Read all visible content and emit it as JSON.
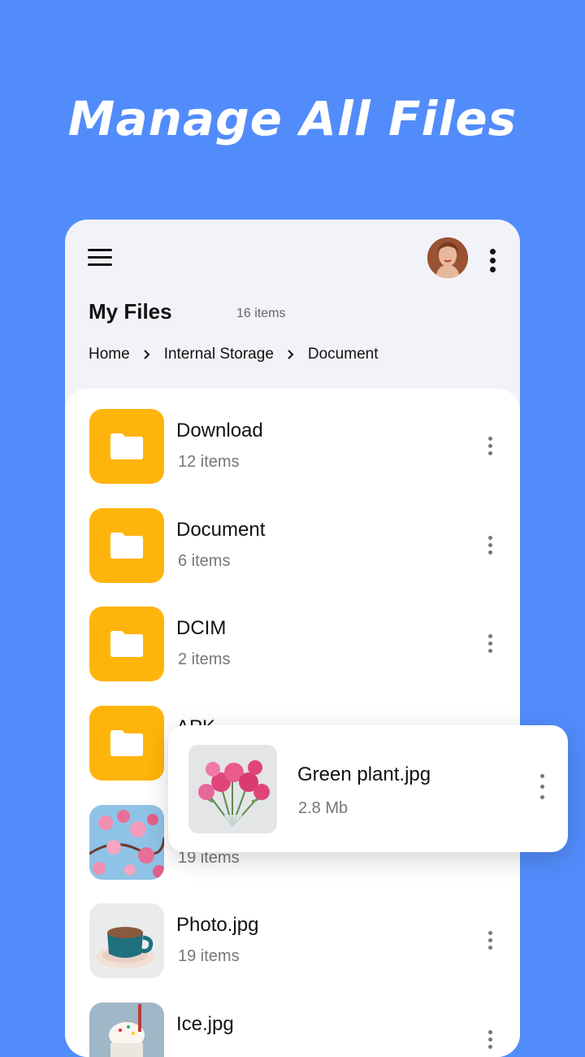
{
  "headline": "Manage All Files",
  "header": {
    "title": "My Files",
    "item_count": "16 items"
  },
  "breadcrumb": [
    "Home",
    "Internal Storage",
    "Document"
  ],
  "files": [
    {
      "name": "Download",
      "sub": "12 items",
      "kind": "folder"
    },
    {
      "name": "Document",
      "sub": "6 items",
      "kind": "folder"
    },
    {
      "name": "DCIM",
      "sub": "2 items",
      "kind": "folder"
    },
    {
      "name": "APK",
      "sub": "",
      "kind": "folder"
    },
    {
      "name": "",
      "sub": "19 items",
      "kind": "image-flowers"
    },
    {
      "name": "Photo.jpg",
      "sub": "19 items",
      "kind": "image-coffee"
    },
    {
      "name": "Ice.jpg",
      "sub": "",
      "kind": "image-icecream"
    }
  ],
  "popup": {
    "name": "Green plant.jpg",
    "size": "2.8 Mb"
  },
  "colors": {
    "background": "#528CFB",
    "folder": "#FFB40B",
    "card": "#F2F3F8"
  },
  "icons": [
    "hamburger-menu-icon",
    "more-vertical-icon",
    "chevron-right-icon",
    "folder-icon"
  ]
}
